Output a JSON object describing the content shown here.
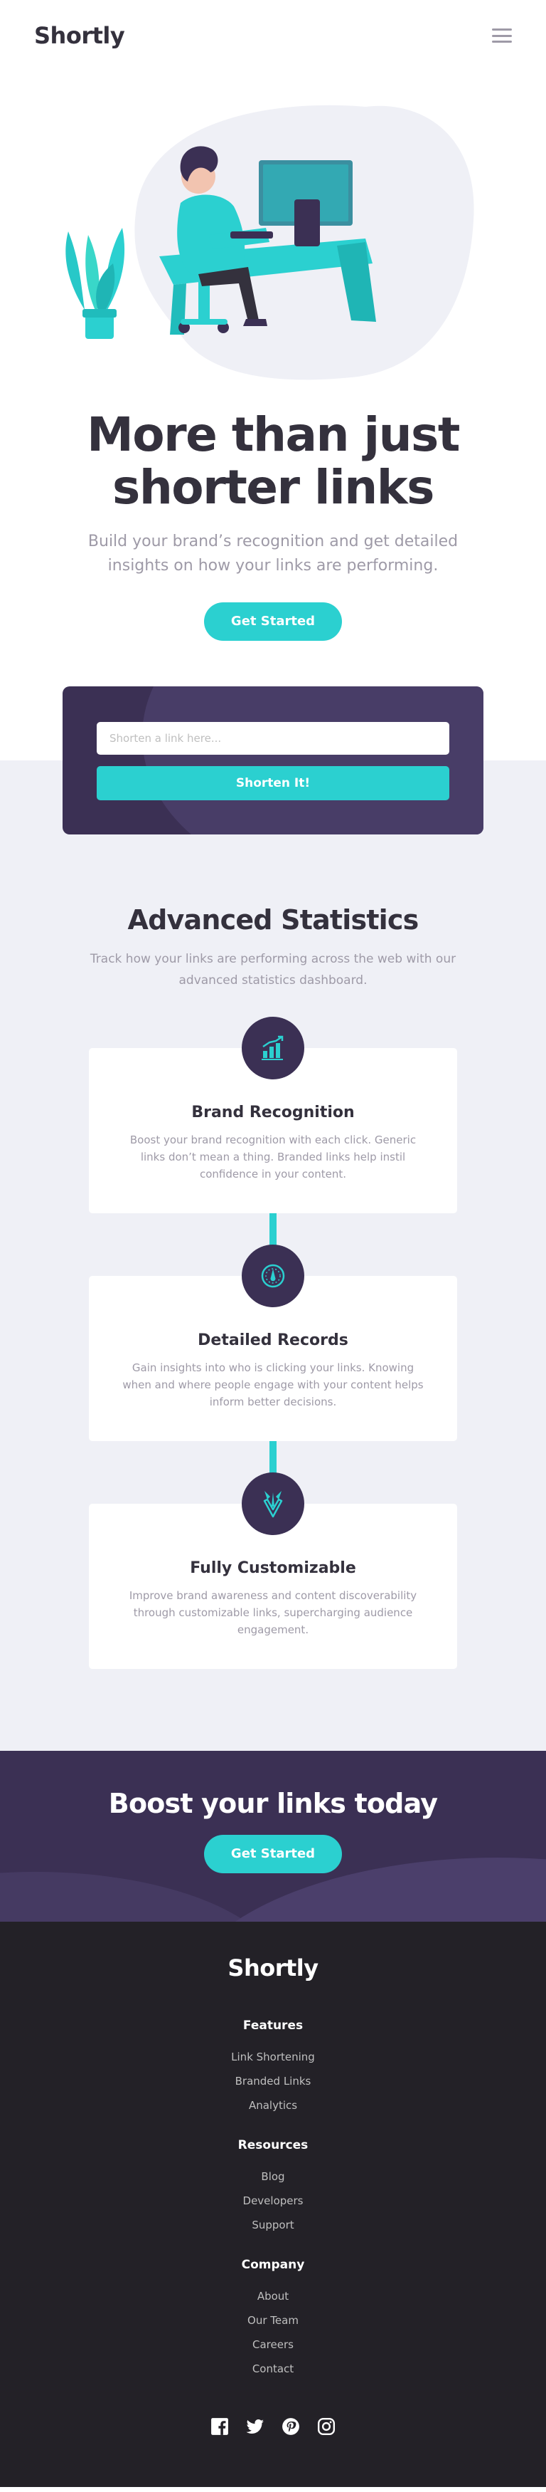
{
  "header": {
    "logo": "Shortly"
  },
  "hero": {
    "title_line1": "More than just",
    "title_line2": "shorter links",
    "subtitle": "Build your brand’s recognition and get detailed insights on how your links are performing.",
    "cta": "Get Started"
  },
  "shorten": {
    "placeholder": "Shorten a link here...",
    "button": "Shorten It!"
  },
  "stats": {
    "title": "Advanced Statistics",
    "subtitle": "Track how your links are performing across the web with our advanced statistics dashboard.",
    "cards": [
      {
        "title": "Brand Recognition",
        "text": "Boost your brand recognition with each click. Generic links don’t mean a thing. Branded links help instil confidence in your content.",
        "icon": "chart-icon"
      },
      {
        "title": "Detailed Records",
        "text": "Gain insights into who is clicking your links. Knowing when and where people engage with your content helps inform better decisions.",
        "icon": "gauge-icon"
      },
      {
        "title": "Fully Customizable",
        "text": "Improve brand awareness and content discoverability through customizable links, supercharging audience engagement.",
        "icon": "brush-icon"
      }
    ]
  },
  "boost": {
    "title": "Boost your links today",
    "cta": "Get Started"
  },
  "footer": {
    "logo": "Shortly",
    "sections": [
      {
        "heading": "Features",
        "links": [
          "Link Shortening",
          "Branded Links",
          "Analytics"
        ]
      },
      {
        "heading": "Resources",
        "links": [
          "Blog",
          "Developers",
          "Support"
        ]
      },
      {
        "heading": "Company",
        "links": [
          "About",
          "Our Team",
          "Careers",
          "Contact"
        ]
      }
    ],
    "socials": [
      "facebook-icon",
      "twitter-icon",
      "pinterest-icon",
      "instagram-icon"
    ]
  },
  "colors": {
    "cyan": "#2bd0d0",
    "dark_violet": "#3b3054",
    "grayish_violet": "#9e9aa7",
    "very_dark_blue": "#34313d",
    "very_dark_violet": "#232127",
    "light_gray": "#eff0f6"
  }
}
